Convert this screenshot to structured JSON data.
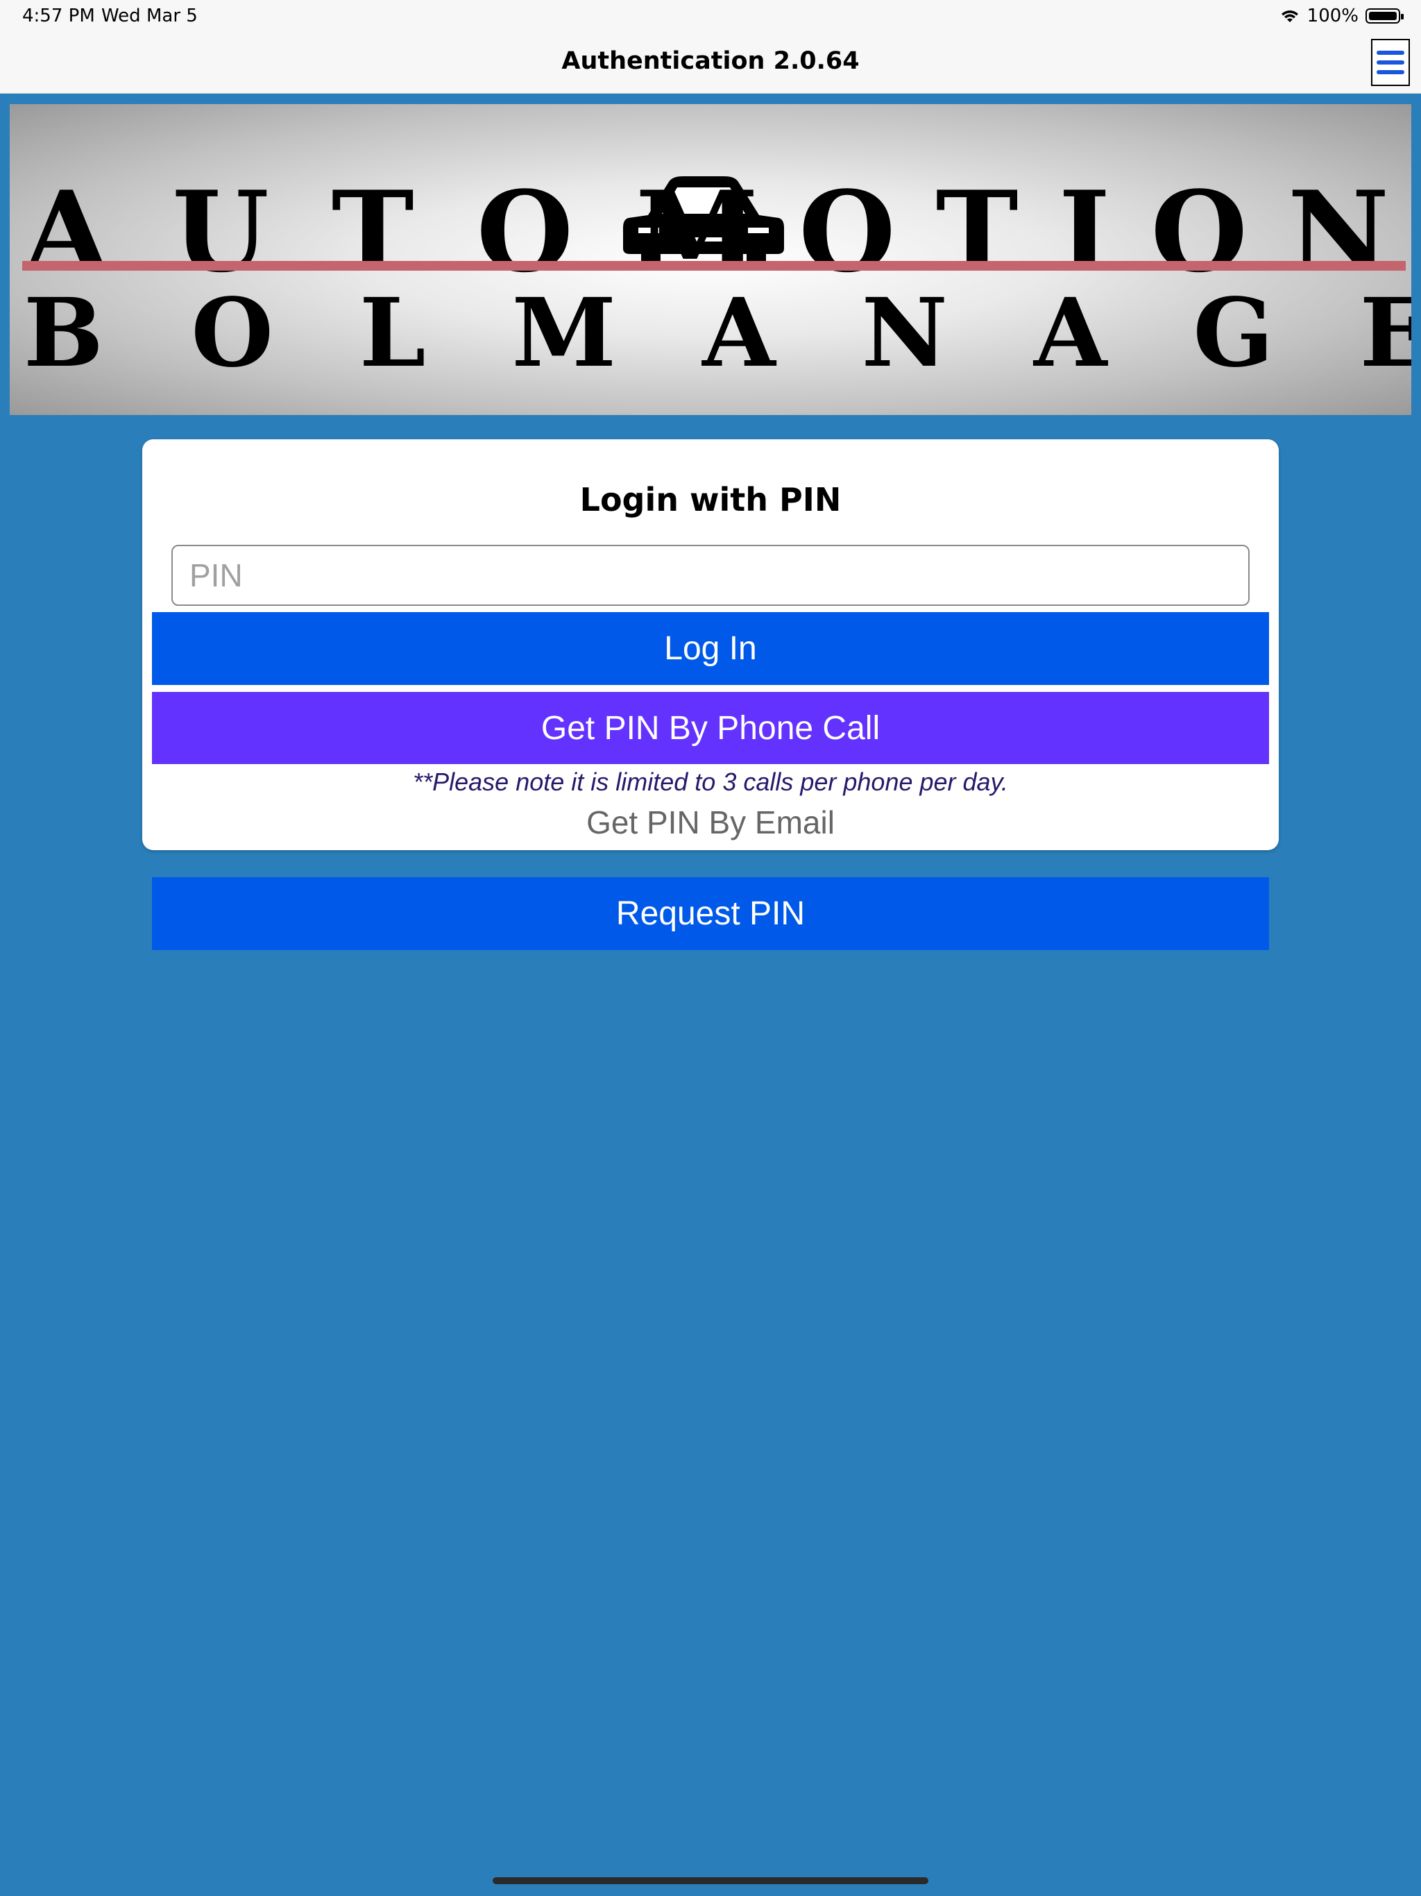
{
  "status_bar": {
    "time": "4:57 PM",
    "date": "Wed Mar 5",
    "battery": "100%",
    "icons": [
      "wifi-icon",
      "battery-icon"
    ]
  },
  "nav": {
    "title": "Authentication 2.0.64",
    "menu_icon": "hamburger-menu-icon"
  },
  "banner": {
    "line1_left": "AUTO",
    "line1_right": "MOTION",
    "line2": "BOLMANAGER",
    "logo_icon": "car-icon",
    "underline_color": "#c4646c"
  },
  "login": {
    "title": "Login with PIN",
    "pin_placeholder": "PIN",
    "pin_value": "",
    "login_button": "Log In",
    "phone_button": "Get PIN By Phone Call",
    "note": "**Please note it is limited to 3 calls per phone per day.",
    "email_link": "Get PIN By Email"
  },
  "request_button": "Request PIN",
  "colors": {
    "background": "#2a7fba",
    "primary_button": "#0059e8",
    "phone_button": "#6332ff",
    "note_text": "#261a6b"
  }
}
